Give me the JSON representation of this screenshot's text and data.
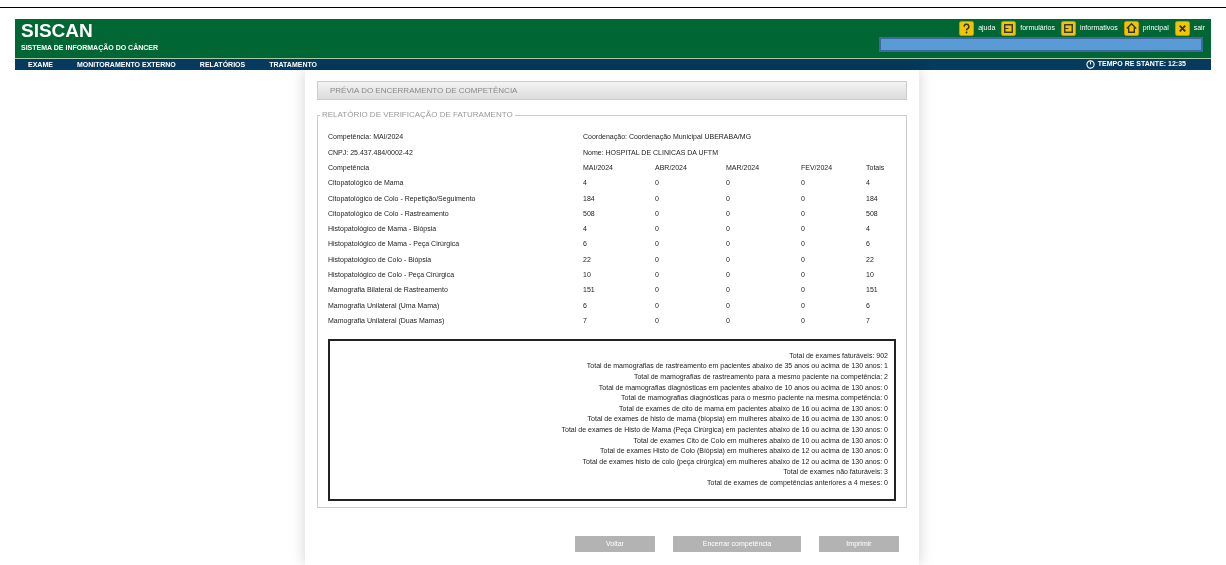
{
  "header": {
    "title": "SISCAN",
    "subtitle": "SISTEMA DE INFORMAÇÃO DO CÂNCER",
    "links": [
      {
        "kind": "help",
        "label": "ajuda"
      },
      {
        "kind": "forms",
        "label": "formulários"
      },
      {
        "kind": "info",
        "label": "informativos"
      },
      {
        "kind": "home",
        "label": "principal"
      },
      {
        "kind": "exit",
        "label": "sair"
      }
    ]
  },
  "menu": [
    "EXAME",
    "MONITORAMENTO EXTERNO",
    "RELATÓRIOS",
    "TRATAMENTO"
  ],
  "timer": "TEMPO RE STANTE: 12:35",
  "panel_title": "PRÉVIA DO ENCERRAMENTO DE COMPETÊNCIA",
  "report": {
    "legend": "RELATÓRIO DE VERIFICAÇÃO DE FATURAMENTO",
    "info": [
      [
        "Competência: MAI/2024",
        "Coordenação: Coordenação Municipal UBERABA/MG"
      ],
      [
        "CNPJ: 25.437.484/0002-42",
        "Nome: HOSPITAL DE CLINICAS DA UFTM"
      ]
    ],
    "columns": [
      "Competência",
      "MAI/2024",
      "ABR/2024",
      "MAR/2024",
      "FEV/2024",
      "Totais"
    ],
    "rows": [
      [
        "Citopatológico de Mama",
        "4",
        "0",
        "0",
        "0",
        "4"
      ],
      [
        "Citopatológico de Colo - Repetição/Seguimento",
        "184",
        "0",
        "0",
        "0",
        "184"
      ],
      [
        "Citopatológico de Colo - Rastreamento",
        "508",
        "0",
        "0",
        "0",
        "508"
      ],
      [
        "Histopatológico de Mama - Biópsia",
        "4",
        "0",
        "0",
        "0",
        "4"
      ],
      [
        "Histopatológico de Mama - Peça Cirúrgica",
        "6",
        "0",
        "0",
        "0",
        "6"
      ],
      [
        "Histopatológico de Colo - Biópsia",
        "22",
        "0",
        "0",
        "0",
        "22"
      ],
      [
        "Histopatológico de Colo - Peça Cirúrgica",
        "10",
        "0",
        "0",
        "0",
        "10"
      ],
      [
        "Mamografia Bilateral de Rastreamento",
        "151",
        "0",
        "0",
        "0",
        "151"
      ],
      [
        "Mamografia Unilateral (Uma Mama)",
        "6",
        "0",
        "0",
        "0",
        "6"
      ],
      [
        "Mamografia Unilateral (Duas Mamas)",
        "7",
        "0",
        "0",
        "0",
        "7"
      ]
    ],
    "summary": [
      "Total de exames faturáveis: 902",
      "Total de mamografias de rastreamento em pacientes abaixo de 35 anos ou acima de 130 anos: 1",
      "Total de mamografias de rastreamento para a mesmo paciente na competência: 2",
      "Total de mamografias diagnósticas em pacientes abaixo de 10 anos ou acima de 130 anos: 0",
      "Total de mamografias diagnósticas para o mesmo paciente na mesma competência: 0",
      "Total de exames de cito de mama em pacientes abaixo de 16 ou acima de 130 anos: 0",
      "Total de exames de histo de mama (biopsia) em mulheres abaixo de 16 ou acima de 130 anos: 0",
      "Total de exames de Histo de Mama (Peça Cirúrgica) em pacientes abaixo de 16 ou acima de 130 anos: 0",
      "Total de exames Cito de Colo em mulheres abaixo de 10 ou acima de 130 anos: 0",
      "Total de exames Histo de Colo (Bíópsia) em mulheres abaixo de 12 ou acima de 130 anos: 0",
      "Total de exames histo de colo (peça cirúrgica) em mulheres abaixo de 12 ou acima de 130 anos: 0",
      "Total de exames não faturáveis: 3",
      "Total de exames de competências anteriores a 4 meses: 0"
    ]
  },
  "buttons": [
    "Voltar",
    "Encerrar competência",
    "Imprimir"
  ]
}
